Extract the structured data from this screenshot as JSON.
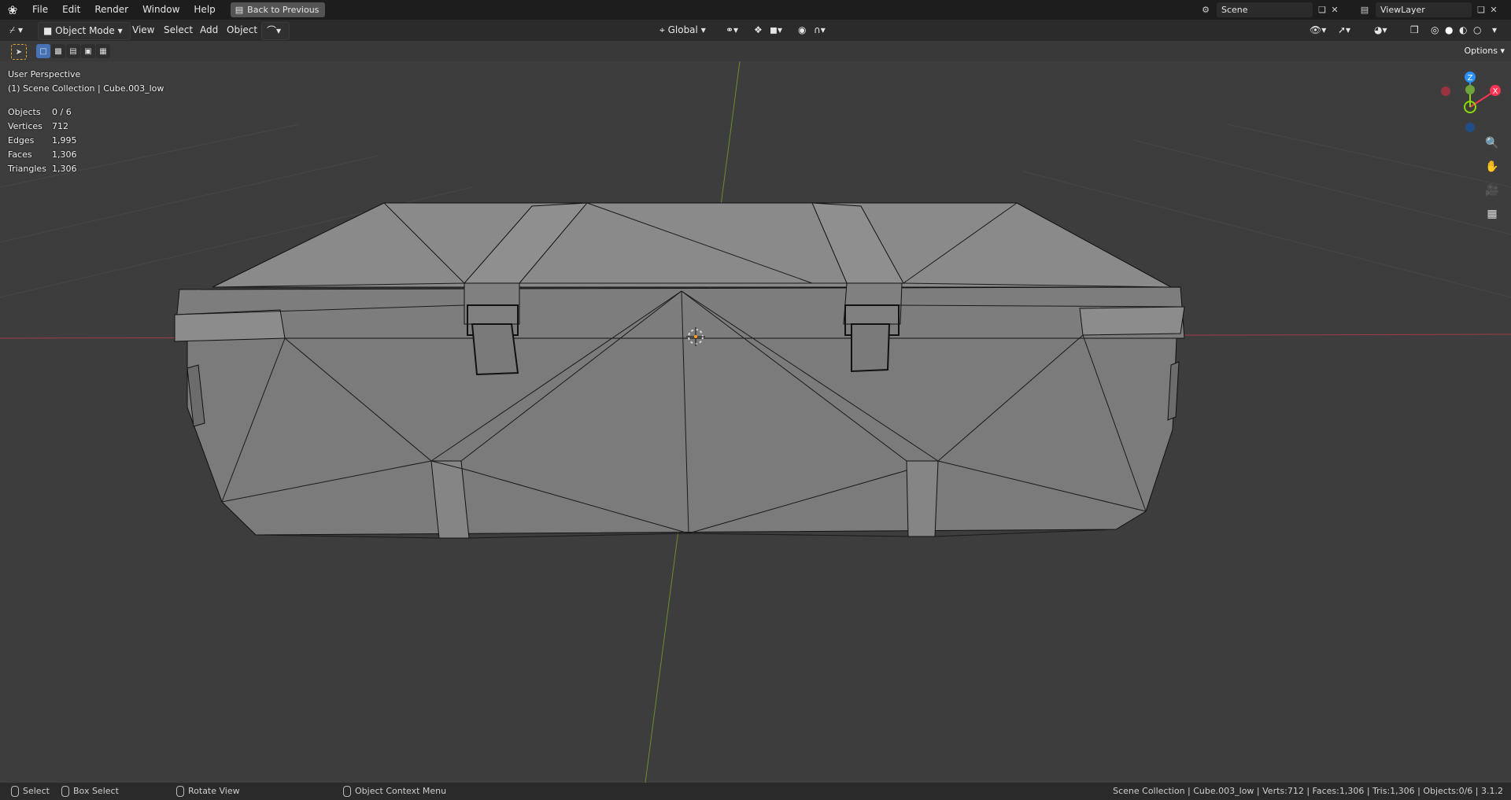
{
  "topbar": {
    "menus": [
      "File",
      "Edit",
      "Render",
      "Window",
      "Help"
    ],
    "back_label": "Back to Previous",
    "scene": "Scene",
    "view_layer": "ViewLayer"
  },
  "header": {
    "mode": "Object Mode",
    "menus": [
      "View",
      "Select",
      "Add",
      "Object"
    ],
    "orientation": "Global",
    "options_label": "Options"
  },
  "viewport": {
    "perspective": "User Perspective",
    "collection_line": "(1) Scene Collection | Cube.003_low",
    "stats": [
      {
        "label": "Objects",
        "value": "0 / 6"
      },
      {
        "label": "Vertices",
        "value": "712"
      },
      {
        "label": "Edges",
        "value": "1,995"
      },
      {
        "label": "Faces",
        "value": "1,306"
      },
      {
        "label": "Triangles",
        "value": "1,306"
      }
    ],
    "gizmo": {
      "z": "Z",
      "y": "Y",
      "x": "X"
    }
  },
  "statusbar": {
    "select": "Select",
    "box_select": "Box Select",
    "rotate_view": "Rotate View",
    "context_menu": "Object Context Menu",
    "info": "Scene Collection | Cube.003_low | Verts:712 | Faces:1,306 | Tris:1,306 | Objects:0/6 | 3.1.2"
  },
  "colors": {
    "accent": "#4772b3",
    "x_axis": "#ff3352",
    "y_axis": "#8bdc00",
    "z_axis": "#2890ff"
  }
}
